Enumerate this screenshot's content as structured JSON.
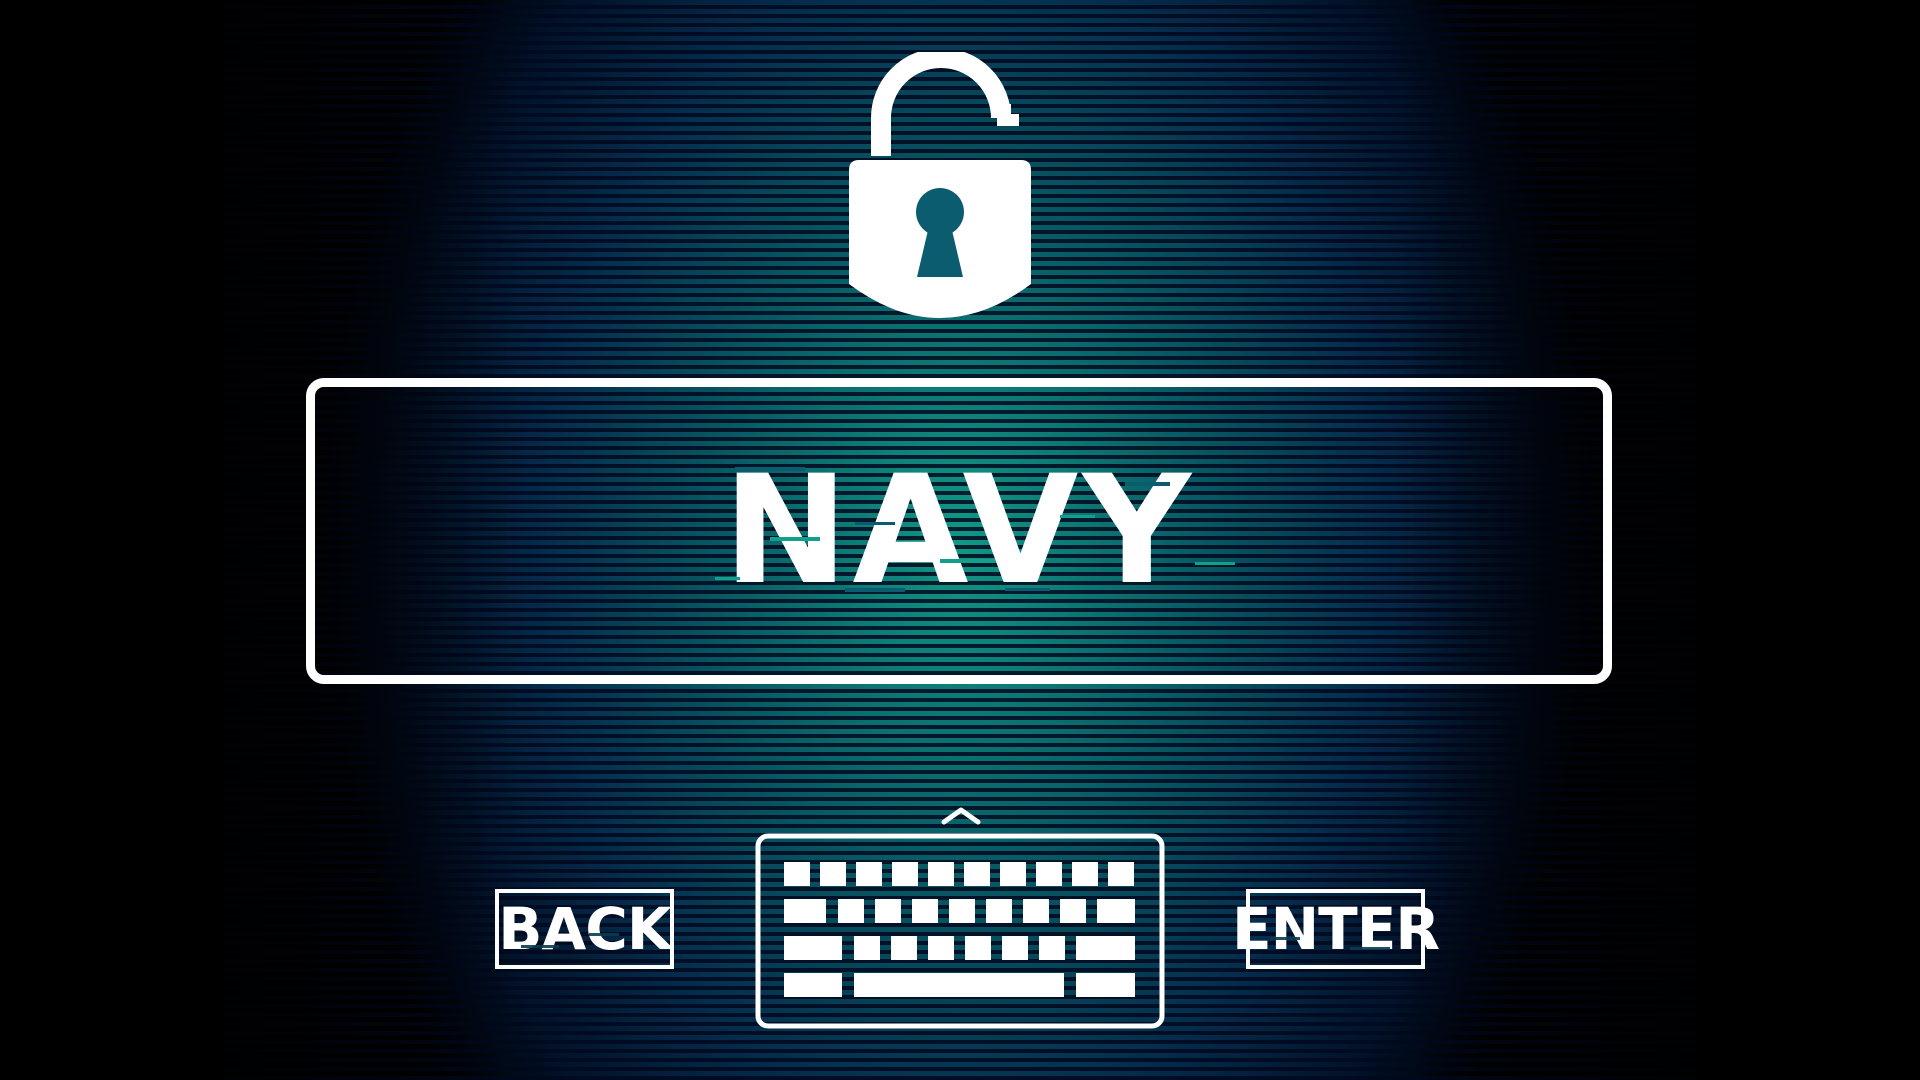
{
  "lock_screen": {
    "lock_icon": "padlock-unlocked-icon",
    "password_input": {
      "value": "NAVY"
    },
    "back_button": {
      "label": "BACK"
    },
    "enter_button": {
      "label": "ENTER"
    },
    "keyboard_icon": "keyboard-icon",
    "chevron_icon": "chevron-up-icon"
  },
  "colors": {
    "accent": "#12a08c",
    "background": "#021a3a",
    "foreground": "#ffffff"
  }
}
